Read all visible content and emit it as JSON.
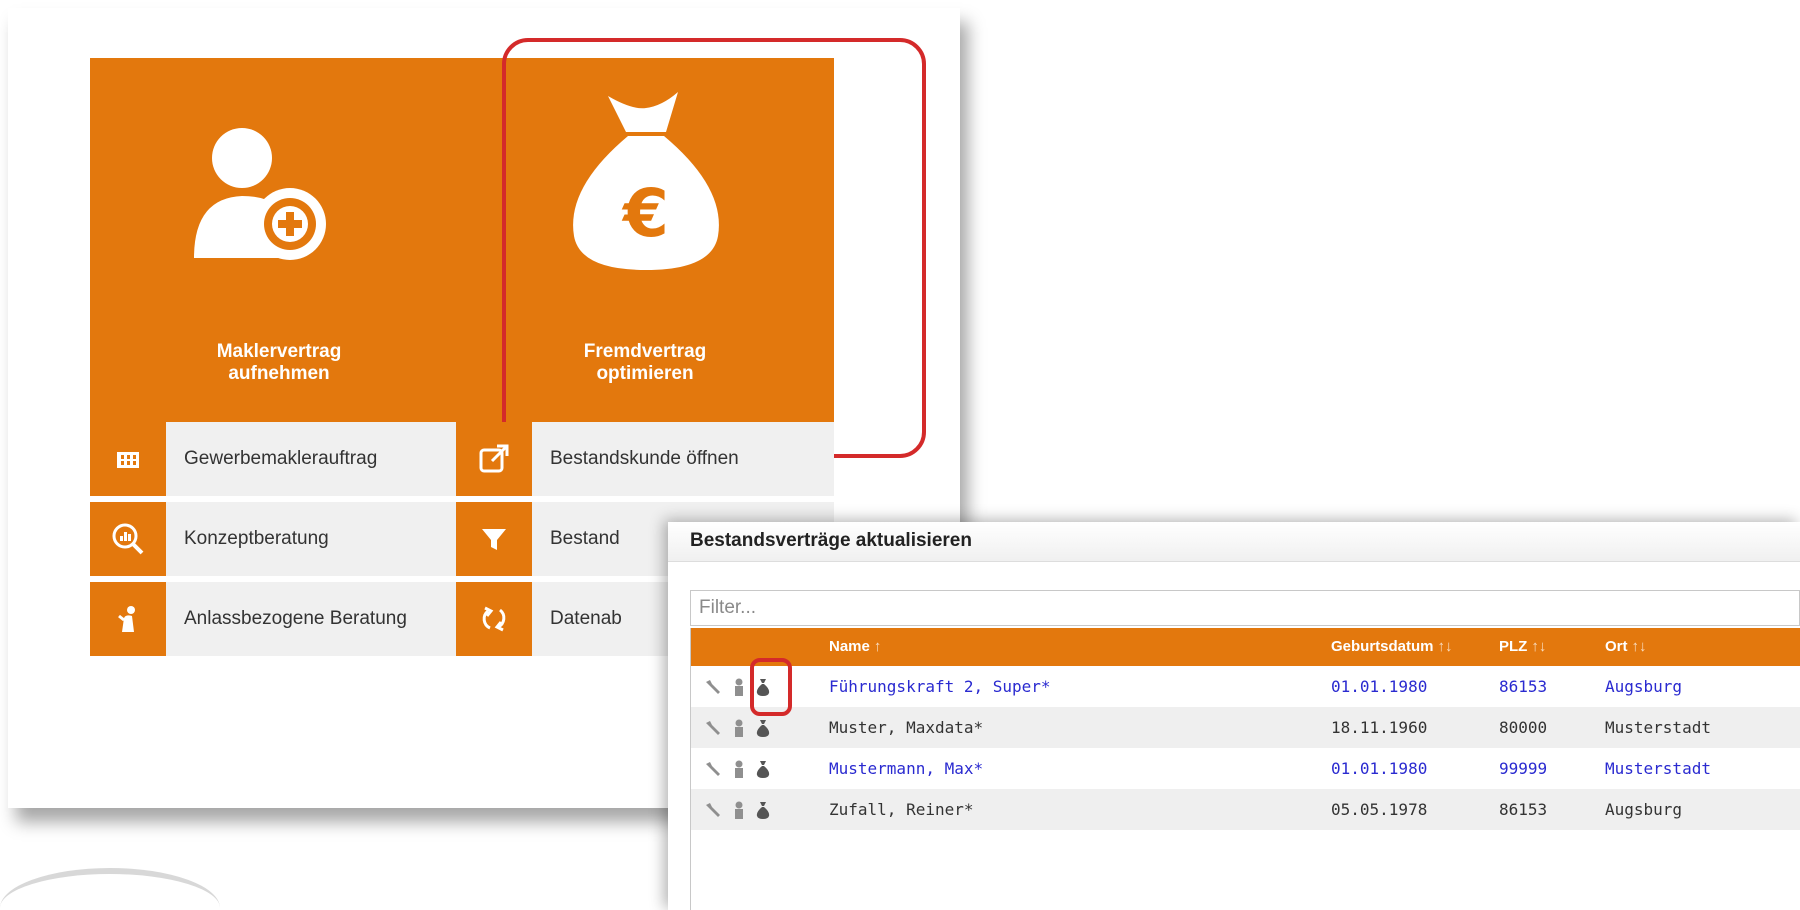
{
  "tiles": {
    "makler": {
      "label": "Maklervertrag\naufnehmen"
    },
    "fremd": {
      "label": "Fremdvertrag\noptimieren"
    }
  },
  "menu": {
    "gewerbe": "Gewerbemaklerauftrag",
    "konzept": "Konzeptberatung",
    "anlass": "Anlassbezogene Beratung",
    "bestandskunde": "Bestandskunde öffnen",
    "bestand": "Bestand",
    "daten": "Datenab"
  },
  "dialog": {
    "title": "Bestandsverträge aktualisieren",
    "filter_placeholder": "Filter...",
    "columns": {
      "name": "Name",
      "name_sort": "↑",
      "geburt": "Geburtsdatum",
      "geburt_sort": "↑↓",
      "plz": "PLZ",
      "plz_sort": "↑↓",
      "ort": "Ort",
      "ort_sort": "↑↓"
    },
    "rows": [
      {
        "name": "Führungskraft 2, Super*",
        "geburt": "01.01.1980",
        "plz": "86153",
        "ort": "Augsburg"
      },
      {
        "name": "Muster, Maxdata*",
        "geburt": "18.11.1960",
        "plz": "80000",
        "ort": "Musterstadt"
      },
      {
        "name": "Mustermann, Max*",
        "geburt": "01.01.1980",
        "plz": "99999",
        "ort": "Musterstadt"
      },
      {
        "name": "Zufall, Reiner*",
        "geburt": "05.05.1978",
        "plz": "86153",
        "ort": "Augsburg"
      }
    ]
  },
  "colors": {
    "accent": "#e3780d",
    "highlight": "#d42a2a",
    "link": "#2a2ad0"
  },
  "icons": [
    "user-add-icon",
    "money-bag-euro-icon",
    "building-icon",
    "magnify-chart-icon",
    "person-hand-icon",
    "external-link-icon",
    "filter-icon",
    "sync-icon",
    "wrench-icon",
    "person-icon"
  ]
}
